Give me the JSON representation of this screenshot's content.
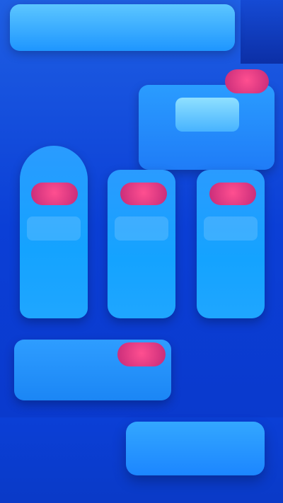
{
  "header": {
    "title": ""
  },
  "top_panel": {
    "left_label": "",
    "big_value": "",
    "badge": ""
  },
  "columns": [
    {
      "badge": "",
      "value": "",
      "sub1": "",
      "sub2": ""
    },
    {
      "badge": "",
      "value": "",
      "sub1": "",
      "sub2": ""
    },
    {
      "badge": "",
      "value": "",
      "sub1": "",
      "sub2": ""
    }
  ],
  "mid_panel": {
    "value": "",
    "badge": "",
    "right_label": ""
  },
  "bottom": {
    "left_label": "",
    "button_label": ""
  },
  "colors": {
    "background": "#0b3fd6",
    "panel": "#1f8bff",
    "badge": "#d9317f"
  }
}
